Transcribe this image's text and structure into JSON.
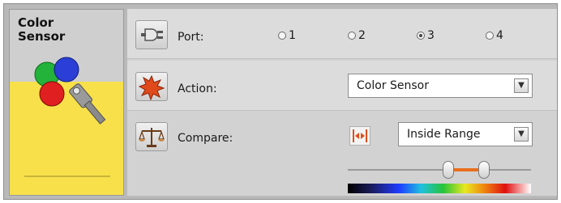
{
  "block": {
    "title_line1": "Color",
    "title_line2": "Sensor"
  },
  "port": {
    "label": "Port:",
    "options": [
      "1",
      "2",
      "3",
      "4"
    ],
    "selected": "3"
  },
  "action": {
    "label": "Action:",
    "value": "Color Sensor"
  },
  "compare": {
    "label": "Compare:",
    "value": "Inside Range"
  },
  "colors": {
    "block_yellow": "#f7e04a",
    "range_orange": "#e8701e",
    "panel_gray": "#d2d2d2"
  },
  "icons": {
    "port": "plug-icon",
    "action": "star-burst-icon",
    "compare": "balance-scale-icon",
    "range_mode": "inside-range-icon",
    "sensor": "color-sensor-icon"
  }
}
